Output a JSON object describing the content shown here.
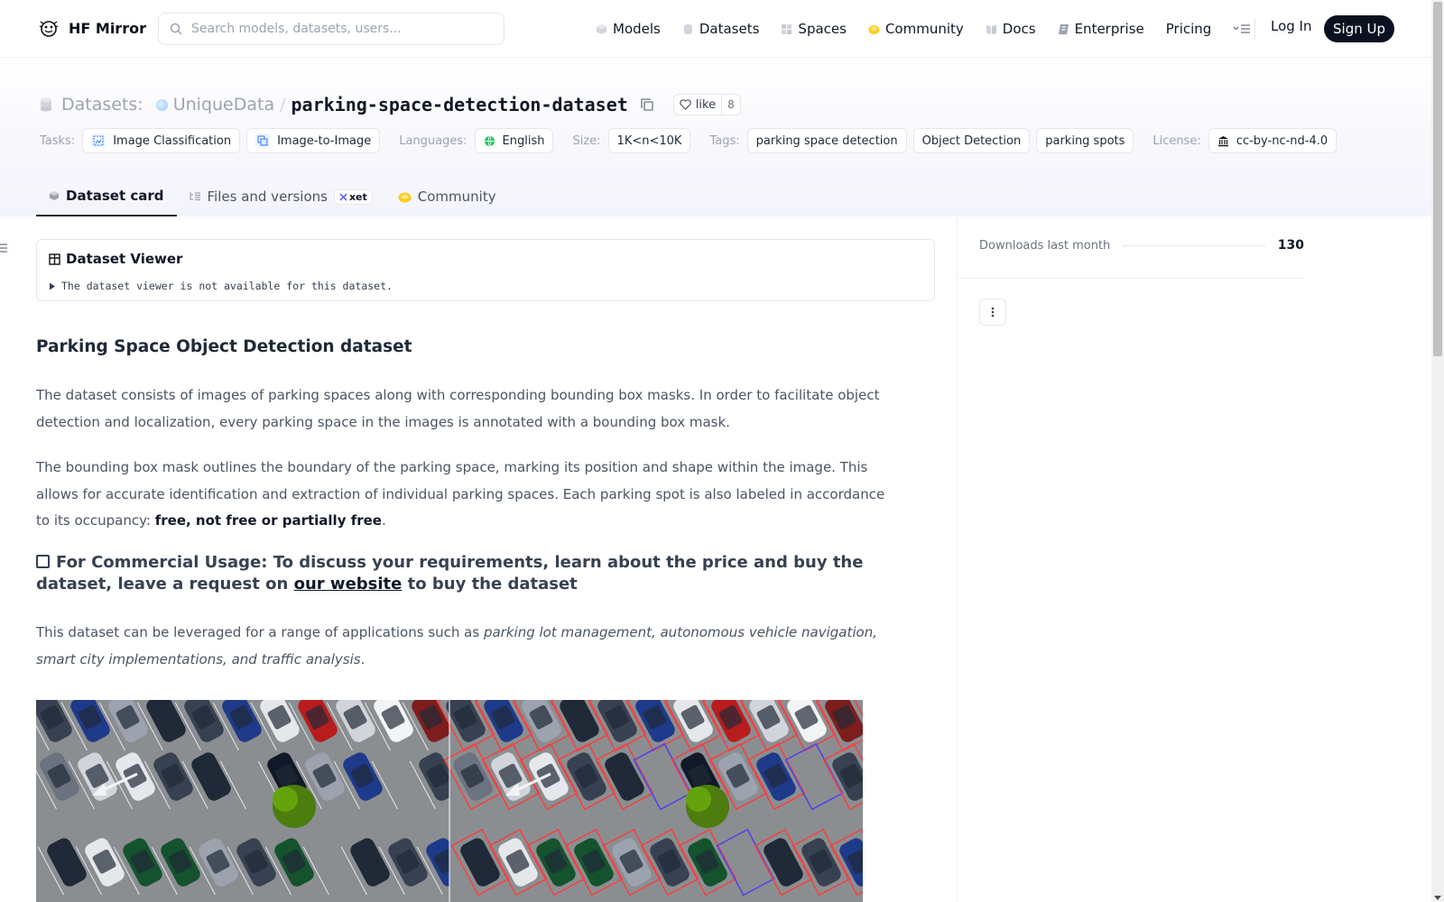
{
  "topnav": {
    "logo_text": "HF Mirror",
    "search_placeholder": "Search models, datasets, users...",
    "links": [
      {
        "label": "Models",
        "icon": "cube-icon"
      },
      {
        "label": "Datasets",
        "icon": "database-icon"
      },
      {
        "label": "Spaces",
        "icon": "spaces-grid-icon"
      },
      {
        "label": "Community",
        "icon": "community-hand-icon"
      },
      {
        "label": "Docs",
        "icon": "book-icon"
      },
      {
        "label": "Enterprise",
        "icon": "enterprise-icon"
      },
      {
        "label": "Pricing",
        "icon": ""
      }
    ],
    "login_label": "Log In",
    "signup_label": "Sign Up"
  },
  "header": {
    "section_label": "Datasets:",
    "org": "UniqueData",
    "separator": "/",
    "repo": "parking-space-detection-dataset",
    "like_label": "like",
    "like_count": "8",
    "tasks_label": "Tasks:",
    "tasks": [
      "Image Classification",
      "Image-to-Image"
    ],
    "languages_label": "Languages:",
    "languages": [
      "English"
    ],
    "size_label": "Size:",
    "size": "1K<n<10K",
    "tags_label": "Tags:",
    "tags": [
      "parking space detection",
      "Object Detection",
      "parking spots"
    ],
    "license_label": "License:",
    "license": "cc-by-nc-nd-4.0"
  },
  "tabs": [
    {
      "label": "Dataset card",
      "active": true
    },
    {
      "label": "Files and versions",
      "badge": "xet"
    },
    {
      "label": "Community"
    }
  ],
  "viewer": {
    "title": "Dataset Viewer",
    "note": "The dataset viewer is not available for this dataset."
  },
  "card": {
    "heading": "Parking Space Object Detection dataset",
    "p1": "The dataset consists of images of parking spaces along with corresponding bounding box masks. In order to facilitate object detection and localization, every parking space in the images is annotated with a bounding box mask.",
    "p2_text": "The bounding box mask outlines the boundary of the parking space, marking its position and shape within the image. This allows for accurate identification and extraction of individual parking spaces. Each parking spot is also labeled in accordance to its occupancy:",
    "p2_bold": "free, not free or partially free",
    "p2_end": ".",
    "commercial_pre": "For Commercial Usage: To discuss your requirements, learn about the price and buy the dataset, leave a request on",
    "commercial_link": "our website",
    "commercial_post": "to buy the dataset",
    "p3_text": "This dataset can be leveraged for a range of applications such as",
    "p3_italic": "parking lot management, autonomous vehicle navigation, smart city implementations, and traffic analysis",
    "p3_end": "."
  },
  "sidebar": {
    "downloads_label": "Downloads last month",
    "downloads_value": "130"
  },
  "colors": {
    "accent_dark": "#0b1120",
    "annotation_red": "#ef4444",
    "annotation_blue": "#4f46e5"
  }
}
